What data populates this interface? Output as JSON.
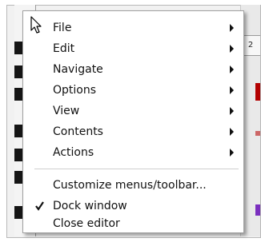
{
  "background": {
    "ruler_label": "2",
    "markers": [
      "#b30000",
      "#cc6666",
      "#7b2fbf"
    ]
  },
  "menu": {
    "items": [
      {
        "label": "File",
        "submenu": true
      },
      {
        "label": "Edit",
        "submenu": true
      },
      {
        "label": "Navigate",
        "submenu": true
      },
      {
        "label": "Options",
        "submenu": true
      },
      {
        "label": "View",
        "submenu": true
      },
      {
        "label": "Contents",
        "submenu": true
      },
      {
        "label": "Actions",
        "submenu": true
      }
    ],
    "extra": [
      {
        "label": "Customize menus/toolbar...",
        "checked": false
      },
      {
        "label": "Dock window",
        "checked": true
      },
      {
        "label": "Close editor",
        "checked": false
      }
    ]
  },
  "icons": {
    "checkmark": "checkmark-icon",
    "cursor": "mouse-pointer-icon",
    "submenu": "submenu-arrow-icon"
  }
}
